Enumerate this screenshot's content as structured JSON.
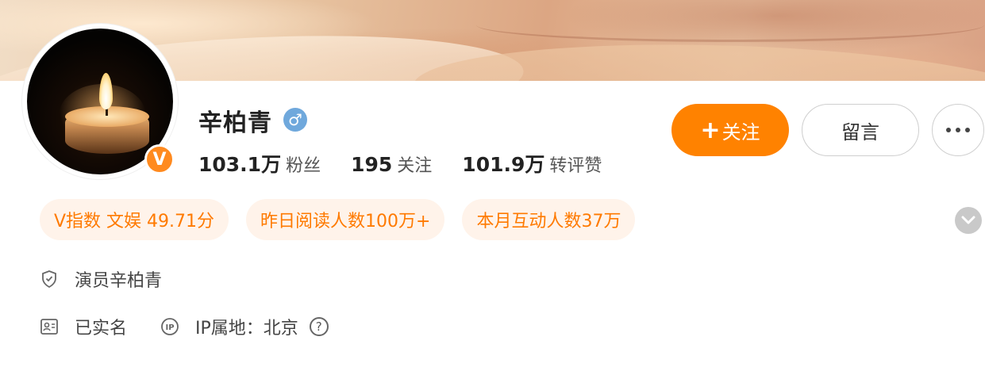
{
  "profile": {
    "name": "辛柏青",
    "verified_badge": "V",
    "gender_symbol": "♂",
    "stats": [
      {
        "value": "103.1万",
        "label": "粉丝"
      },
      {
        "value": "195",
        "label": "关注"
      },
      {
        "value": "101.9万",
        "label": "转评赞"
      }
    ]
  },
  "actions": {
    "follow_plus": "+",
    "follow_label": "关注",
    "message_label": "留言"
  },
  "chips": [
    "V指数 文娱 49.71分",
    "昨日阅读人数100万+",
    "本月互动人数37万"
  ],
  "info": {
    "title_line": "演员辛柏青",
    "realname": "已实名",
    "ip_location": "IP属地：北京",
    "help_symbol": "?"
  },
  "colors": {
    "accent": "#ff8200",
    "chip_bg": "#fff3ea",
    "chip_text": "#ff7a00",
    "gender_blue": "#6fa8dc"
  },
  "icons": {
    "more": "more-dots-icon",
    "expand": "chevron-down-icon",
    "title": "shield-icon",
    "realname": "id-card-icon",
    "ip": "ip-icon",
    "help": "question-circle-icon"
  }
}
